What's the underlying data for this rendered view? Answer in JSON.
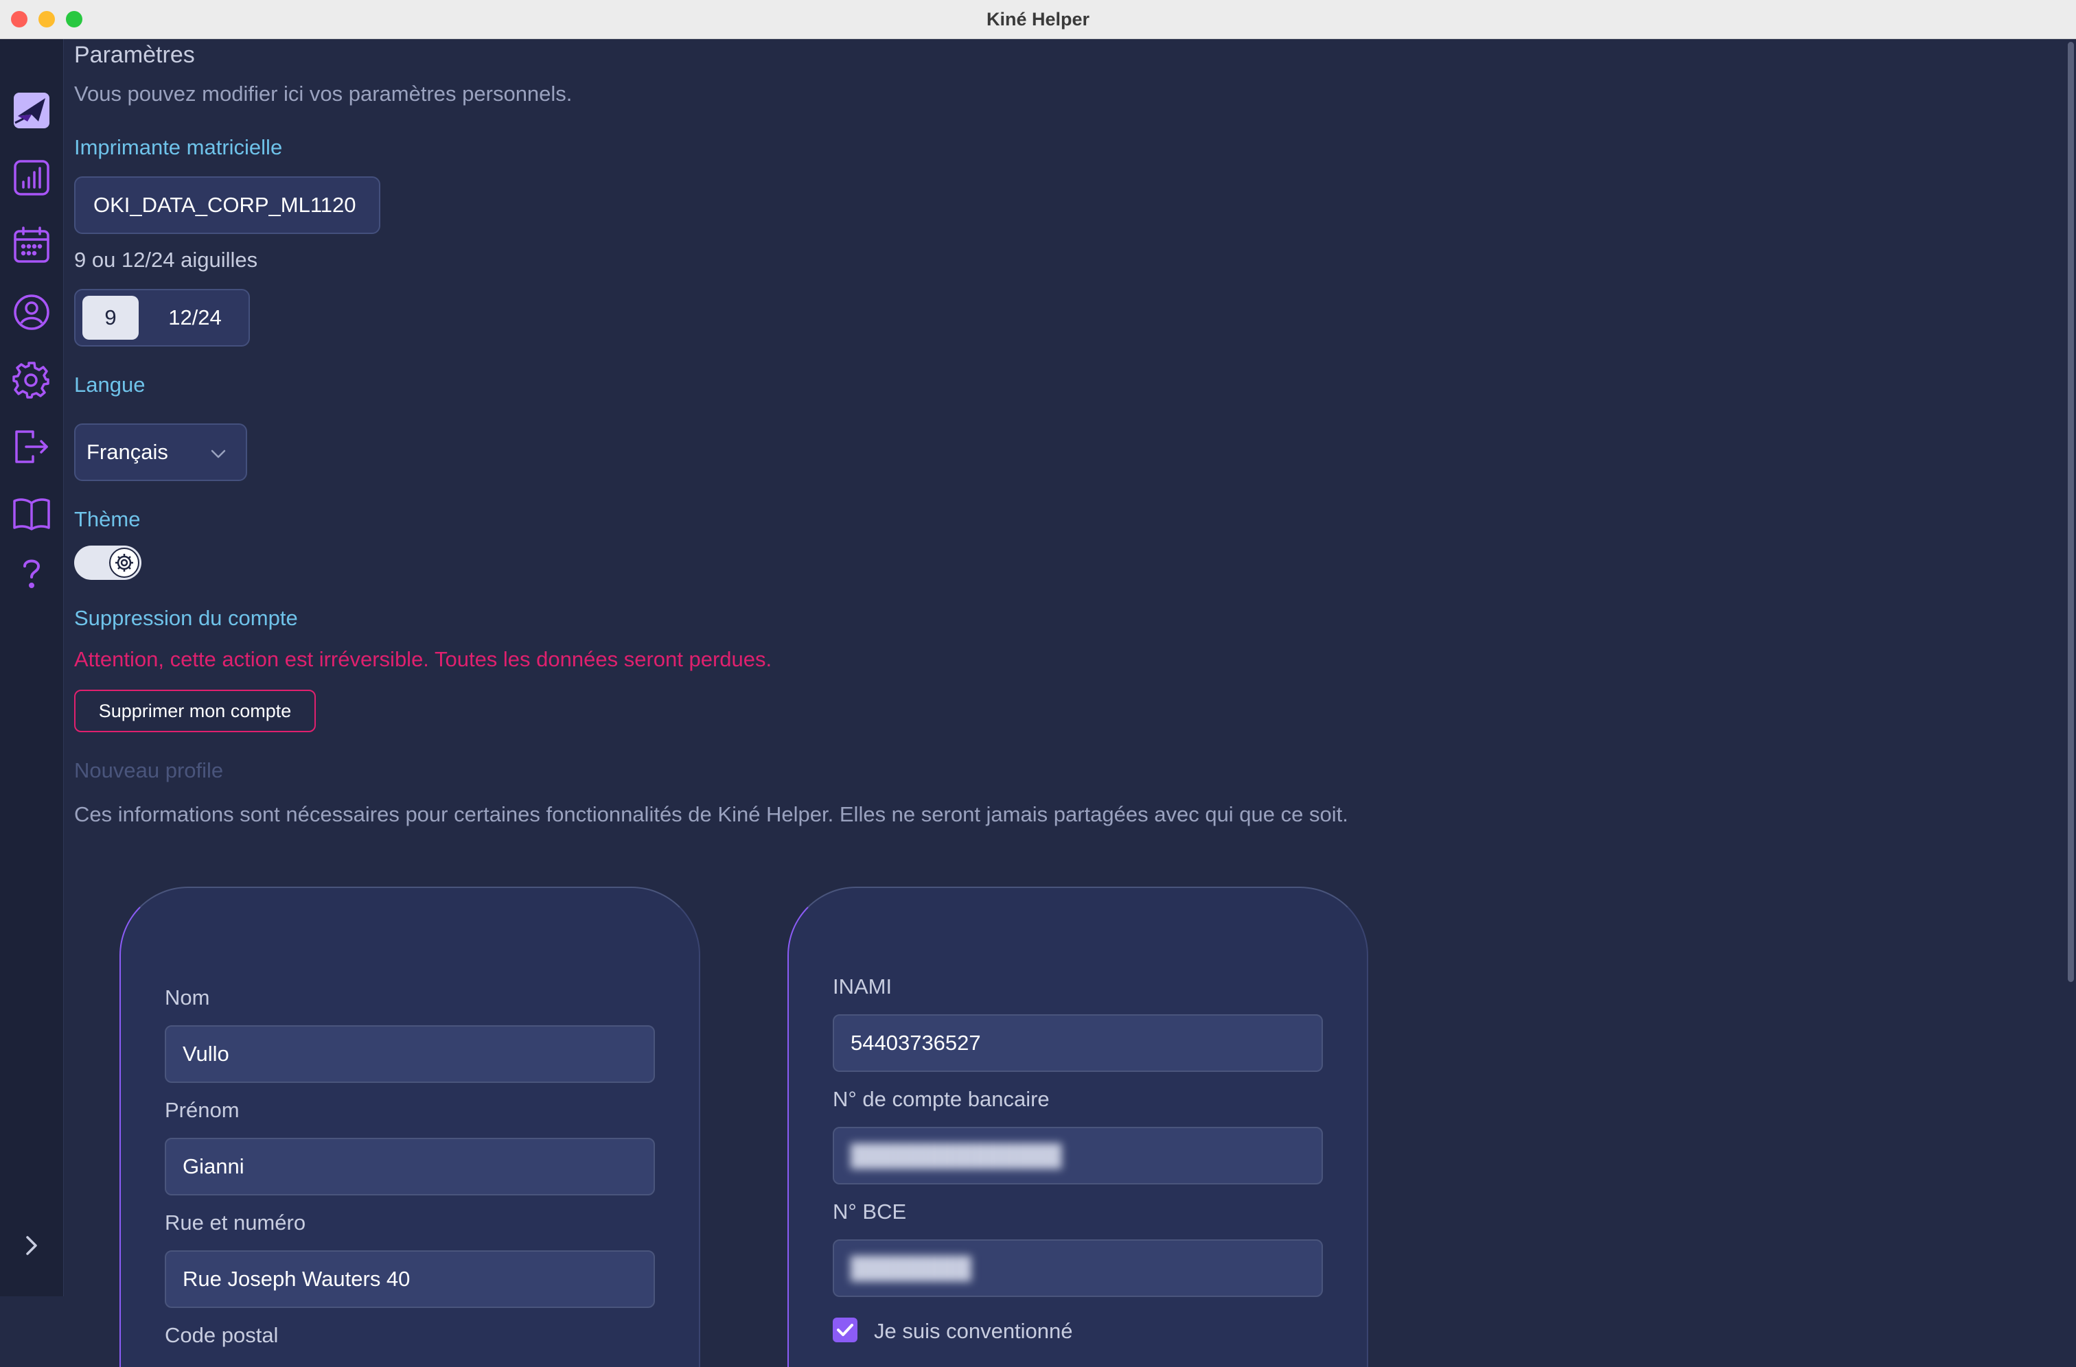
{
  "window": {
    "title": "Kiné Helper"
  },
  "sidebar": {
    "items": [
      {
        "icon": "paper-plane-icon",
        "label": ""
      },
      {
        "icon": "chart-icon"
      },
      {
        "icon": "calendar-icon"
      },
      {
        "icon": "user-icon"
      },
      {
        "icon": "gear-icon"
      },
      {
        "icon": "logout-icon"
      },
      {
        "icon": "book-icon"
      },
      {
        "icon": "help-icon"
      }
    ],
    "expand_icon": "chevron-right-icon",
    "accent_color": "#a855f7"
  },
  "page": {
    "title": "Paramètres",
    "subtitle": "Vous pouvez modifier ici vos paramètres personnels."
  },
  "printer": {
    "section_label": "Imprimante matricielle",
    "value": "OKI_DATA_CORP_ML1120",
    "pins_label": "9 ou 12/24 aiguilles",
    "pins_options": [
      "9",
      "12/24"
    ],
    "pins_selected": "9"
  },
  "language": {
    "section_label": "Langue",
    "selected": "Français"
  },
  "theme": {
    "section_label": "Thème"
  },
  "account_deletion": {
    "section_label": "Suppression du compte",
    "warning": "Attention, cette action est irréversible. Toutes les données seront perdues.",
    "button_label": "Supprimer mon compte"
  },
  "profile": {
    "new_profile_label": "Nouveau profile",
    "info": "Ces informations sont nécessaires pour certaines fonctionnalités de Kiné Helper. Elles ne seront jamais partagées avec qui que ce soit.",
    "left_card": {
      "nom_label": "Nom",
      "nom_value": "Vullo",
      "prenom_label": "Prénom",
      "prenom_value": "Gianni",
      "rue_label": "Rue et numéro",
      "rue_value": "Rue Joseph Wauters 40",
      "postal_label": "Code postal"
    },
    "right_card": {
      "inami_label": "INAMI",
      "inami_value": "54403736527",
      "bank_label": "N° de compte bancaire",
      "bce_label": "N° BCE",
      "conventionne_label": "Je suis conventionné",
      "conventionne_checked": true
    }
  },
  "colors": {
    "background": "#232a45",
    "section_label": "#6fc3ea",
    "danger": "#e0206e",
    "accent": "#8b5cf6"
  }
}
